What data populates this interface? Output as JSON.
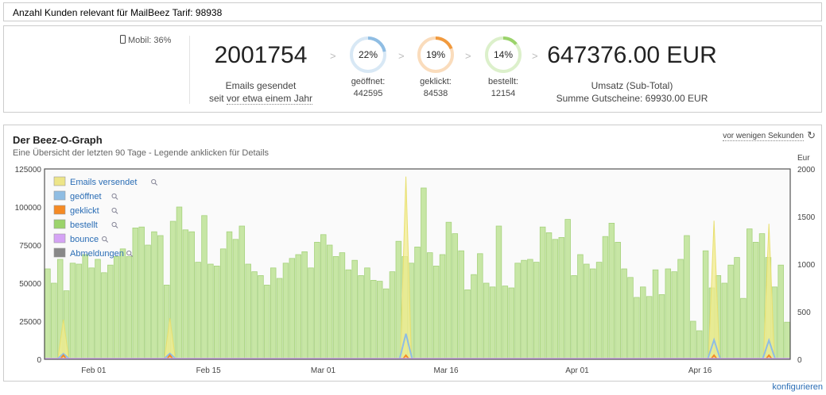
{
  "topbar": {
    "text": "Anzahl Kunden relevant für MailBeez Tarif: 98938"
  },
  "stats": {
    "mobile": "Mobil: 36%",
    "emails_sent": "2001754",
    "emails_sent_label": "Emails gesendet",
    "since_prefix": "seit",
    "since_link": "vor etwa einem Jahr",
    "arrow": ">",
    "kpis": [
      {
        "percent": "22%",
        "value": 0.22,
        "label": "geöffnet:",
        "count": "442595",
        "color": "#8fbde3"
      },
      {
        "percent": "19%",
        "value": 0.19,
        "label": "geklickt:",
        "count": "84538",
        "color": "#f19a3e"
      },
      {
        "percent": "14%",
        "value": 0.14,
        "label": "bestellt:",
        "count": "12154",
        "color": "#9bd36b"
      }
    ],
    "revenue": "647376.00 EUR",
    "revenue_label": "Umsatz (Sub-Total)",
    "vouchers": "Summe Gutscheine: 69930.00 EUR"
  },
  "graph": {
    "title": "Der Beez-O-Graph",
    "subtitle": "Eine Übersicht der letzten 90 Tage - Legende anklicken für Details",
    "refreshed": "vor wenigen Sekunden",
    "refresh_icon": "refresh-icon",
    "configure": "konfigurieren"
  },
  "chart_data": {
    "type": "bar",
    "left_axis": {
      "min": 0,
      "max": 125000,
      "ticks": [
        "0",
        "25000",
        "50000",
        "75000",
        "100000",
        "125000"
      ]
    },
    "right_axis": {
      "label": "Eur",
      "min": 0,
      "max": 2000,
      "ticks": [
        "0",
        "500",
        "1000",
        "1500",
        "2000"
      ]
    },
    "x_ticks": [
      {
        "label": "Feb 01",
        "index": 6
      },
      {
        "label": "Feb 15",
        "index": 20
      },
      {
        "label": "Mar 01",
        "index": 34
      },
      {
        "label": "Mar 16",
        "index": 49
      },
      {
        "label": "Apr 01",
        "index": 65
      },
      {
        "label": "Apr 16",
        "index": 80
      }
    ],
    "legend": [
      {
        "name": "Emails versendet",
        "color": "#ede588"
      },
      {
        "name": "geöffnet",
        "color": "#8fbde3"
      },
      {
        "name": "geklickt",
        "color": "#f58a24"
      },
      {
        "name": "bestellt",
        "color": "#9bd36b"
      },
      {
        "name": "bounce",
        "color": "#d5a3f5"
      },
      {
        "name": "Abmeldungen",
        "color": "#888888"
      }
    ],
    "series": [
      {
        "name": "bestellt (Eur)",
        "axis": "right",
        "type": "bar",
        "values": [
          950,
          800,
          1050,
          720,
          1010,
          1000,
          1100,
          960,
          1050,
          910,
          990,
          1080,
          1160,
          1080,
          1380,
          1390,
          1200,
          1340,
          1300,
          780,
          1450,
          1600,
          1360,
          1340,
          1020,
          1510,
          1000,
          980,
          1160,
          1340,
          1260,
          1400,
          1000,
          920,
          880,
          780,
          960,
          850,
          1010,
          1060,
          1100,
          1130,
          960,
          1230,
          1310,
          1200,
          1080,
          1120,
          940,
          1040,
          880,
          960,
          830,
          820,
          740,
          920,
          1240,
          1080,
          1010,
          1180,
          1800,
          1120,
          980,
          1100,
          1440,
          1320,
          1140,
          730,
          890,
          1110,
          800,
          760,
          1400,
          770,
          750,
          1010,
          1040,
          1050,
          1020,
          1390,
          1330,
          1260,
          1280,
          1470,
          880,
          1100,
          1000,
          950,
          1020,
          1290,
          1430,
          1230,
          950,
          860,
          650,
          760,
          660,
          940,
          680,
          950,
          920,
          1050,
          1300,
          400,
          300,
          1140,
          750,
          880,
          800,
          990,
          1070,
          640,
          1370,
          1230,
          1320,
          1070,
          760,
          990,
          390
        ],
        "note": "estimated daily bar heights"
      }
    ]
  }
}
